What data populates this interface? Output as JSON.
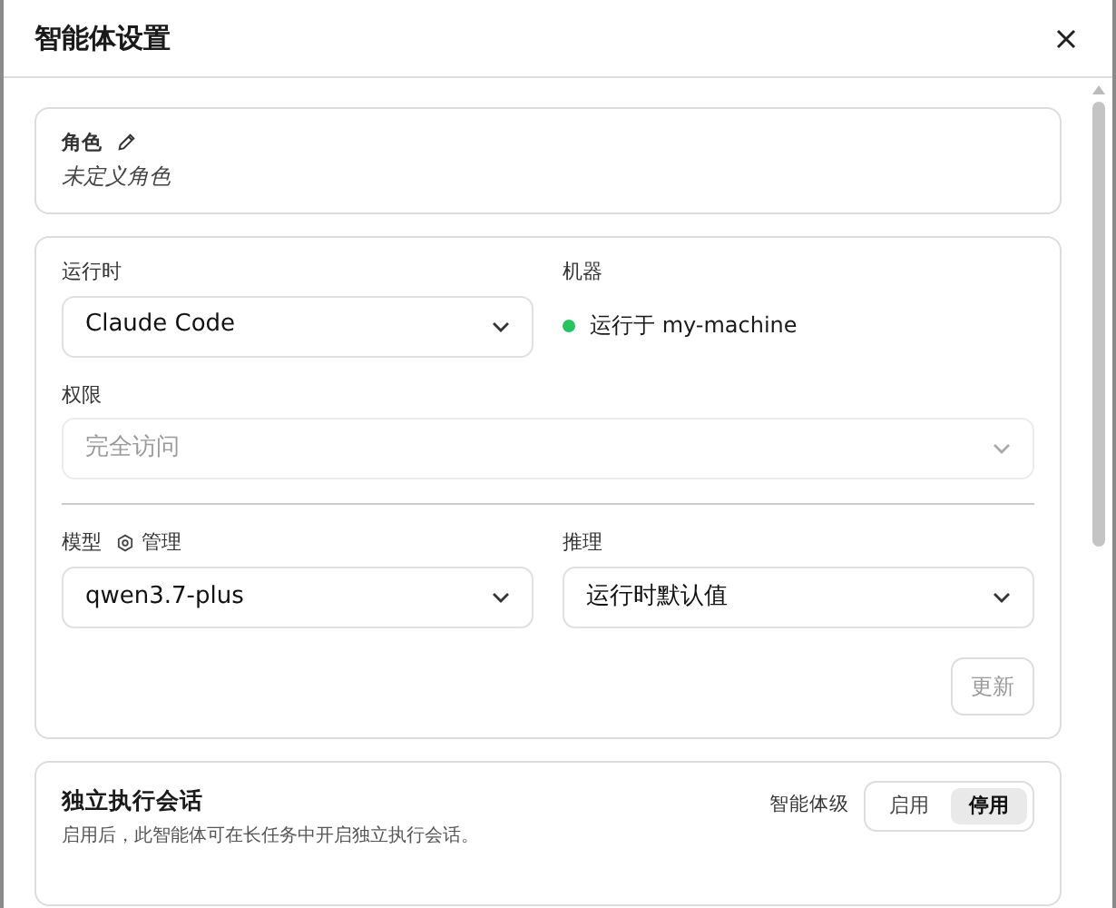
{
  "dialog": {
    "title": "智能体设置"
  },
  "role": {
    "label": "角色",
    "value": "未定义角色"
  },
  "runtime": {
    "label": "运行时",
    "value": "Claude Code"
  },
  "machine": {
    "label": "机器",
    "status": "运行于 my-machine",
    "online": true
  },
  "permission": {
    "label": "权限",
    "value": "完全访问",
    "disabled": true
  },
  "model": {
    "label": "模型",
    "manage": "管理",
    "value": "qwen3.7-plus"
  },
  "reasoning": {
    "label": "推理",
    "value": "运行时默认值"
  },
  "update_button": {
    "label": "更新",
    "disabled": true
  },
  "isolated_sessions": {
    "title": "独立执行会话",
    "description": "启用后，此智能体可在长任务中开启独立执行会话。",
    "scope_label": "智能体级",
    "options": [
      {
        "label": "启用",
        "selected": false
      },
      {
        "label": "停用",
        "selected": true
      }
    ]
  }
}
